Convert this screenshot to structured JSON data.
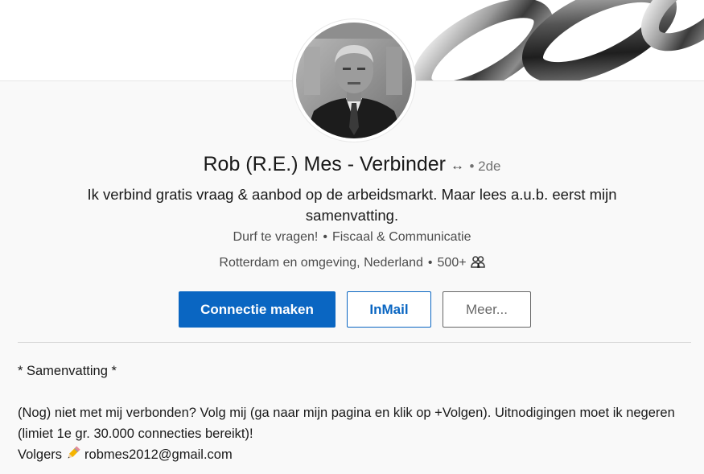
{
  "profile": {
    "name": "Rob (R.E.) Mes - Verbinder",
    "connection_icon": "↔",
    "degree": "• 2de",
    "headline": "Ik verbind gratis vraag & aanbod op de arbeidsmarkt. Maar lees a.u.b. eerst mijn samenvatting.",
    "tagline": "Durf te vragen!",
    "industry": "Fiscaal & Communicatie",
    "location": "Rotterdam en omgeving, Nederland",
    "connections": "500+",
    "separator": "•"
  },
  "actions": {
    "connect_label": "Connectie maken",
    "inmail_label": "InMail",
    "more_label": "Meer..."
  },
  "summary": {
    "title": "* Samenvatting *",
    "paragraph": "(Nog) niet met mij verbonden? Volg mij (ga naar mijn pagina en klik op +Volgen). Uitnodigingen moet ik negeren (limiet 1e gr. 30.000 connecties bereikt)!",
    "followers_label": "Volgers",
    "email": "robmes2012@gmail.com"
  },
  "icons": {
    "connection": "bidirectional-arrow-icon",
    "connections_count": "people-icon",
    "pencil": "pencil-icon",
    "banner": "chain-links-image",
    "avatar": "profile-photo"
  },
  "colors": {
    "primary": "#0a66c2",
    "background": "#f9f9f9"
  }
}
